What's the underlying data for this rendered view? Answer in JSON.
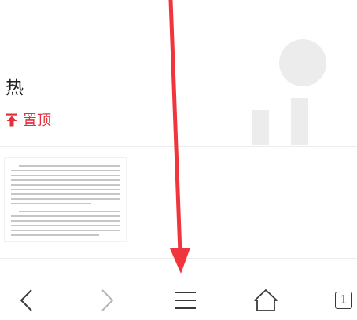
{
  "article": {
    "title": "热",
    "pin_label": "置顶"
  },
  "bottom_nav": {
    "tab_count": "1"
  },
  "colors": {
    "pin_red": "#e0313a",
    "arrow_red": "#f0363c",
    "icon_dark": "#3a3a3a",
    "icon_disabled": "#b5b5b5"
  },
  "icons": [
    "pin-icon",
    "back-icon",
    "forward-icon",
    "menu-icon",
    "home-icon",
    "tabs-icon",
    "annotation-arrow"
  ]
}
